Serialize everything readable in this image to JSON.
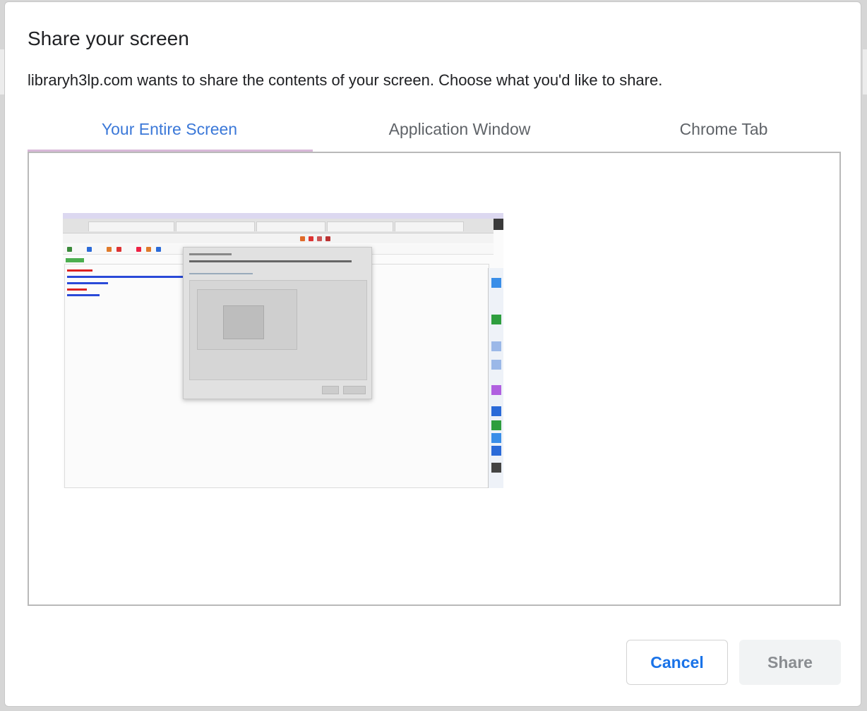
{
  "dialog": {
    "title": "Share your screen",
    "subtitle": "libraryh3lp.com wants to share the contents of your screen. Choose what you'd like to share."
  },
  "tabs": [
    {
      "label": "Your Entire Screen",
      "active": true
    },
    {
      "label": "Application Window",
      "active": false
    },
    {
      "label": "Chrome Tab",
      "active": false
    }
  ],
  "buttons": {
    "cancel_label": "Cancel",
    "share_label": "Share",
    "share_enabled": false
  },
  "colors": {
    "active_tab": "#3b78d8",
    "inactive_tab": "#5f6368",
    "tab_underline": "#d8b8d8",
    "cancel_text": "#1a73e8",
    "share_text_disabled": "#8a8d91"
  }
}
